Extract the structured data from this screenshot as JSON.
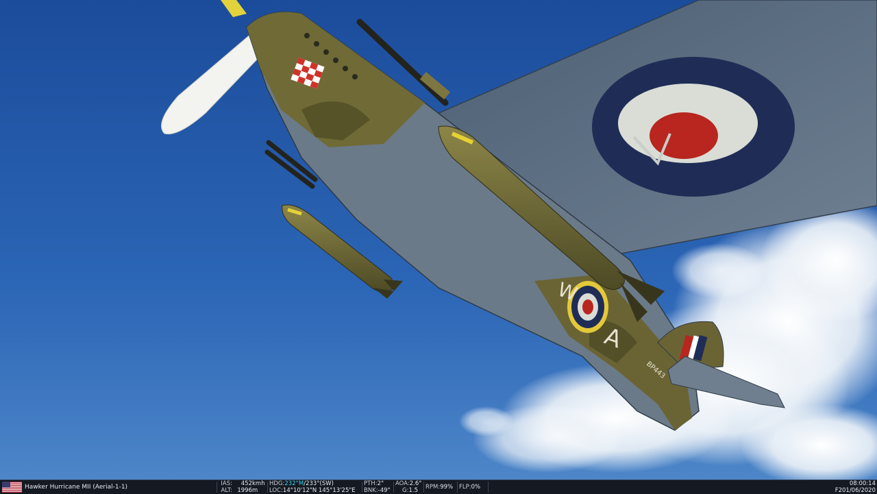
{
  "scene": {
    "description_icon": "aircraft-underside-view",
    "colors": {
      "sky_top": "#1c4d9c",
      "sky_bottom": "#3f7dc8",
      "camo_olive": "#6f6a36",
      "underside": "#55677b",
      "roundel_blue": "#1f2d56",
      "roundel_red": "#b8261f"
    },
    "markings": {
      "fuselage_code": "BP443"
    }
  },
  "hud": {
    "flag_icon": "us-flag-icon",
    "unit_name": "Hawker Hurricane MII (Aerial-1-1)",
    "ias_label": "IAS:",
    "ias_value": "452",
    "ias_unit": "kmh",
    "alt_label": "ALT:",
    "alt_value": "1996",
    "alt_unit": "m",
    "hdg_label": "HDG:",
    "hdg_mag": "232°M",
    "hdg_true": "/233°(SW)",
    "loc_label": "LOC:",
    "loc_value": "14°10'12\"N 145°13'25\"E",
    "pth_label": "PTH:",
    "pth_value": "2°",
    "bnk_label": "BNK:",
    "bnk_value": "-49°",
    "aoa_label": "AOA:",
    "aoa_value": "2.6°",
    "g_label": "G:",
    "g_value": "1.5",
    "rpm_label": "RPM:",
    "rpm_value": "99%",
    "flp_label": "FLP:",
    "flp_value": "0%",
    "time": "08:00:14",
    "date": "F201/06/2020"
  }
}
